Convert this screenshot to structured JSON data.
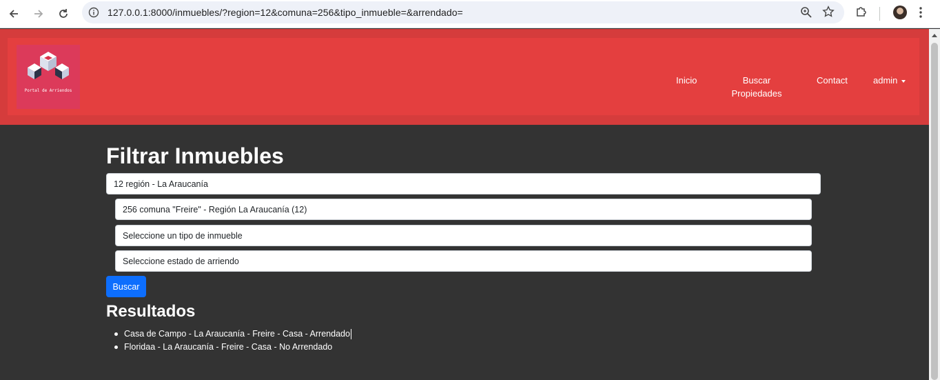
{
  "browser": {
    "url": "127.0.0.1:8000/inmuebles/?region=12&comuna=256&tipo_inmueble=&arrendado="
  },
  "header": {
    "logo_text": "Portal de Arriendos",
    "nav": {
      "inicio": "Inicio",
      "buscar_line1": "Buscar",
      "buscar_line2": "Propiedades",
      "contacto": "Contact",
      "user": "admin"
    }
  },
  "main": {
    "title": "Filtrar Inmuebles",
    "filters": {
      "region": "12 región - La Araucanía",
      "comuna": "256 comuna \"Freire\" - Región La Araucanía (12)",
      "tipo_inmueble": "Seleccione un tipo de inmueble",
      "arrendado": "Seleccione estado de arriendo"
    },
    "search_button": "Buscar",
    "results_title": "Resultados",
    "results": [
      "Casa de Campo - La Araucanía - Freire - Casa - Arrendado",
      "Floridaa - La Araucanía - Freire - Casa - No Arrendado"
    ]
  }
}
